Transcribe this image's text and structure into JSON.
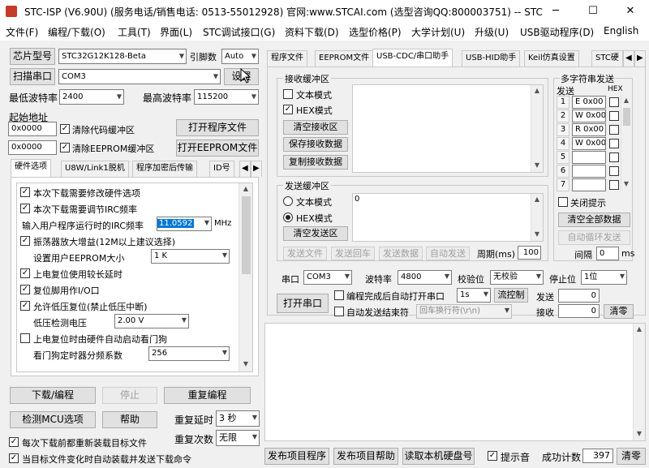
{
  "window": {
    "title": "STC-ISP (V6.90U) (服务电话/销售电话: 0513-55012928) 官网:www.STCAI.com  (选型咨询QQ:800003751) -- STC:"
  },
  "menu": [
    "文件(F)",
    "编程/下载(O)",
    "工具(T)",
    "界面(L)",
    "STC调试接口(G)",
    "资料下载(D)",
    "选型价格(P)",
    "大学计划(U)",
    "升级(U)",
    "USB驱动程序(D)",
    "English"
  ],
  "left": {
    "chip_label": "芯片型号",
    "chip_value": "STC32G12K128-Beta",
    "pin_label": "引脚数",
    "pin_value": "Auto",
    "scan_button": "扫描串口",
    "port_value": "COM3",
    "settings_button": "设置",
    "min_baud_label": "最低波特率",
    "min_baud_value": "2400",
    "max_baud_label": "最高波特率",
    "max_baud_value": "115200",
    "start_addr_label": "起始地址",
    "code_addr": "0x0000",
    "clear_code_label": "清除代码缓冲区",
    "open_program_button": "打开程序文件",
    "eeprom_addr": "0x0000",
    "clear_eeprom_label": "清除EEPROM缓冲区",
    "open_eeprom_button": "打开EEPROM文件",
    "tabs": [
      "硬件选项",
      "U8W/Link1脱机",
      "程序加密后传输",
      "ID号"
    ],
    "hw_options": [
      "本次下载需要修改硬件选项",
      "本次下载需要调节IRC频率",
      "输入用户程序运行时的IRC频率",
      "振荡器放大增益(12M以上建议选择)",
      "设置用户EEPROM大小",
      "上电复位使用较长延时",
      "复位脚用作I/O口",
      "允许低压复位(禁止低压中断)",
      "低压检测电压",
      "上电复位时由硬件自动启动看门狗",
      "看门狗定时器分频系数"
    ],
    "irc_value": "11.0592",
    "irc_unit": "MHz",
    "eeprom_size": "1    K",
    "lvd_value": "2.00 V",
    "wdt_value": "256",
    "download_button": "下载/编程",
    "stop_button": "停止",
    "reprogram_button": "重复编程",
    "check_mcu_button": "检测MCU选项",
    "help_button": "帮助",
    "repeat_delay_label": "重复延时",
    "repeat_delay_value": "3 秒",
    "repeat_count_label": "重复次数",
    "repeat_count_value": "无限",
    "reload_label": "每次下载前都重新装载目标文件",
    "auto_load_label": "当目标文件变化时自动装载并发送下载命令"
  },
  "right": {
    "tabs": [
      "程序文件",
      "EEPROM文件",
      "USB-CDC/串口助手",
      "USB-HID助手",
      "Keil仿真设置",
      "STC硬"
    ],
    "receive_group": "接收缓冲区",
    "text_mode": "文本模式",
    "hex_mode": "HEX模式",
    "clear_receive": "清空接收区",
    "save_receive": "保存接收数据",
    "copy_receive": "复制接收数据",
    "send_group": "发送缓冲区",
    "send_text_mode": "文本模式",
    "send_hex_mode": "HEX模式",
    "clear_send": "清空发送区",
    "send_content": "0",
    "send_file": "发送文件",
    "send_return": "发送回车",
    "send_data": "发送数据",
    "auto_send": "自动发送",
    "period_label": "周期(ms)",
    "period_value": "100",
    "multi_title": "多字符串发送",
    "col_send": "发送",
    "col_hex": "HEX",
    "multi_rows": [
      {
        "n": "1",
        "v": "E 0x00"
      },
      {
        "n": "2",
        "v": "W 0x00"
      },
      {
        "n": "3",
        "v": "R 0x00"
      },
      {
        "n": "4",
        "v": "W 0x00"
      },
      {
        "n": "5",
        "v": ""
      },
      {
        "n": "6",
        "v": ""
      },
      {
        "n": "7",
        "v": ""
      }
    ],
    "close_hint": "关闭提示",
    "clear_all": "清空全部数据",
    "auto_cycle": "自动循环发送",
    "interval_label": "间隔",
    "interval_value": "0",
    "interval_unit": "ms",
    "port_label": "串口",
    "port_value": "COM3",
    "baud_label": "波特率",
    "baud_value": "4800",
    "parity_label": "校验位",
    "parity_value": "无校验",
    "stop_label": "停止位",
    "stop_value": "1位",
    "open_port": "打开串口",
    "auto_open_label": "编程完成后自动打开串口",
    "auto_open_delay": "1s",
    "flow_button": "流控制",
    "auto_send_end_label": "自动发送结束符",
    "end_char_value": "回车换行符(\\r\\n)",
    "send_count_label": "发送",
    "send_count": "0",
    "recv_count_label": "接收",
    "recv_count": "0",
    "clear_count": "清零",
    "publish_program": "发布项目程序",
    "publish_help": "发布项目帮助",
    "read_disk": "读取本机硬盘号",
    "beep_label": "提示音",
    "success_label": "成功计数",
    "success_value": "397",
    "clear_success": "清零"
  }
}
